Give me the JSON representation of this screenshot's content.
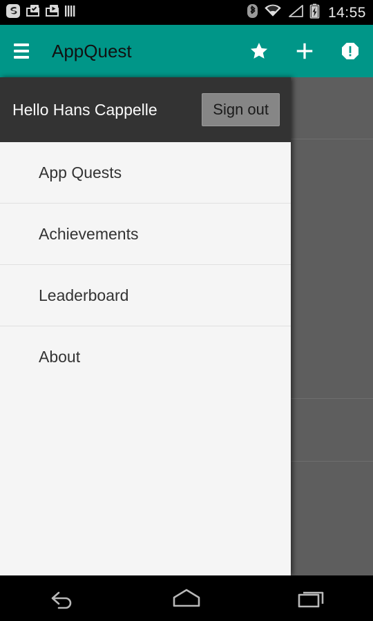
{
  "status_bar": {
    "left_icons": [
      {
        "name": "app-logo-icon"
      },
      {
        "name": "briefcase-check-icon"
      },
      {
        "name": "briefcase-play-icon"
      },
      {
        "name": "bars-icon"
      }
    ],
    "right_icons": [
      {
        "name": "bluetooth-icon"
      },
      {
        "name": "wifi-icon"
      },
      {
        "name": "signal-icon"
      },
      {
        "name": "battery-charging-icon"
      }
    ],
    "clock": "14:55"
  },
  "app_bar": {
    "menu_icon": "hamburger-icon",
    "title": "AppQuest",
    "actions": [
      {
        "name": "star-icon",
        "label": "Favorites"
      },
      {
        "name": "plus-icon",
        "label": "Add"
      },
      {
        "name": "report-icon",
        "label": "Report"
      }
    ],
    "background_color": "#009688"
  },
  "drawer": {
    "greeting": "Hello Hans Cappelle",
    "sign_out_label": "Sign out",
    "header_background": "#333333",
    "background": "#f5f5f5",
    "items": [
      {
        "label": "App Quests"
      },
      {
        "label": "Achievements"
      },
      {
        "label": "Leaderboard"
      },
      {
        "label": "About"
      }
    ]
  },
  "scrim": {
    "color": "#5e5e5e"
  },
  "nav_bar": {
    "buttons": [
      {
        "name": "back-icon",
        "label": "Back"
      },
      {
        "name": "home-icon",
        "label": "Home"
      },
      {
        "name": "recents-icon",
        "label": "Recents"
      }
    ]
  }
}
